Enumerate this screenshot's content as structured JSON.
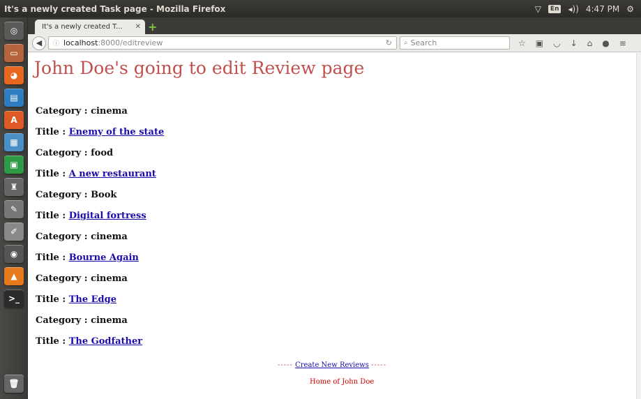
{
  "window": {
    "title": "It's a newly created Task page - Mozilla Firefox",
    "keyboard_layout": "En",
    "volume_icon": "volume-icon",
    "clock": "4:47 PM"
  },
  "launcher": {
    "apps": [
      {
        "name": "dash-icon",
        "glyph": "◎",
        "color": "#5a5a58"
      },
      {
        "name": "files-icon",
        "glyph": "▭",
        "color": "#b6643b"
      },
      {
        "name": "firefox-icon",
        "glyph": "◕",
        "color": "#e8671f"
      },
      {
        "name": "writer-icon",
        "glyph": "▤",
        "color": "#2f7dc0"
      },
      {
        "name": "software-center-icon",
        "glyph": "A",
        "color": "#dd5a26"
      },
      {
        "name": "impress-icon",
        "glyph": "▦",
        "color": "#4a8fc5"
      },
      {
        "name": "pycharm-icon",
        "glyph": "▣",
        "color": "#2d9b45"
      },
      {
        "name": "tool-icon",
        "glyph": "♜",
        "color": "#666"
      },
      {
        "name": "inkscape-icon",
        "glyph": "✎",
        "color": "#777"
      },
      {
        "name": "editor-icon",
        "glyph": "✐",
        "color": "#888"
      },
      {
        "name": "screenshot-icon",
        "glyph": "◉",
        "color": "#555"
      },
      {
        "name": "vlc-icon",
        "glyph": "▲",
        "color": "#e87a1e"
      },
      {
        "name": "terminal-icon",
        "glyph": ">_",
        "color": "#2b2b2b"
      },
      {
        "name": "trash-icon",
        "glyph": "🗑",
        "color": "#666"
      }
    ]
  },
  "browser": {
    "tab_title": "It's a newly created T...",
    "url_host": "localhost",
    "url_rest": ":8000/editreview",
    "search_placeholder": "Search"
  },
  "page": {
    "title": "John Doe's going to edit Review page",
    "category_prefix": "Category : ",
    "title_prefix": "Title : ",
    "reviews": [
      {
        "category": "cinema",
        "title": "Enemy of the state"
      },
      {
        "category": "food",
        "title": "A new restaurant"
      },
      {
        "category": "Book",
        "title": "Digital fortress"
      },
      {
        "category": "cinema",
        "title": "Bourne Again"
      },
      {
        "category": "cinema",
        "title": "The Edge"
      },
      {
        "category": "cinema",
        "title": "The Godfather"
      }
    ],
    "footer_dots": "-----",
    "create_link": "Create New Reviews",
    "home_text": "Home of John Doe"
  }
}
